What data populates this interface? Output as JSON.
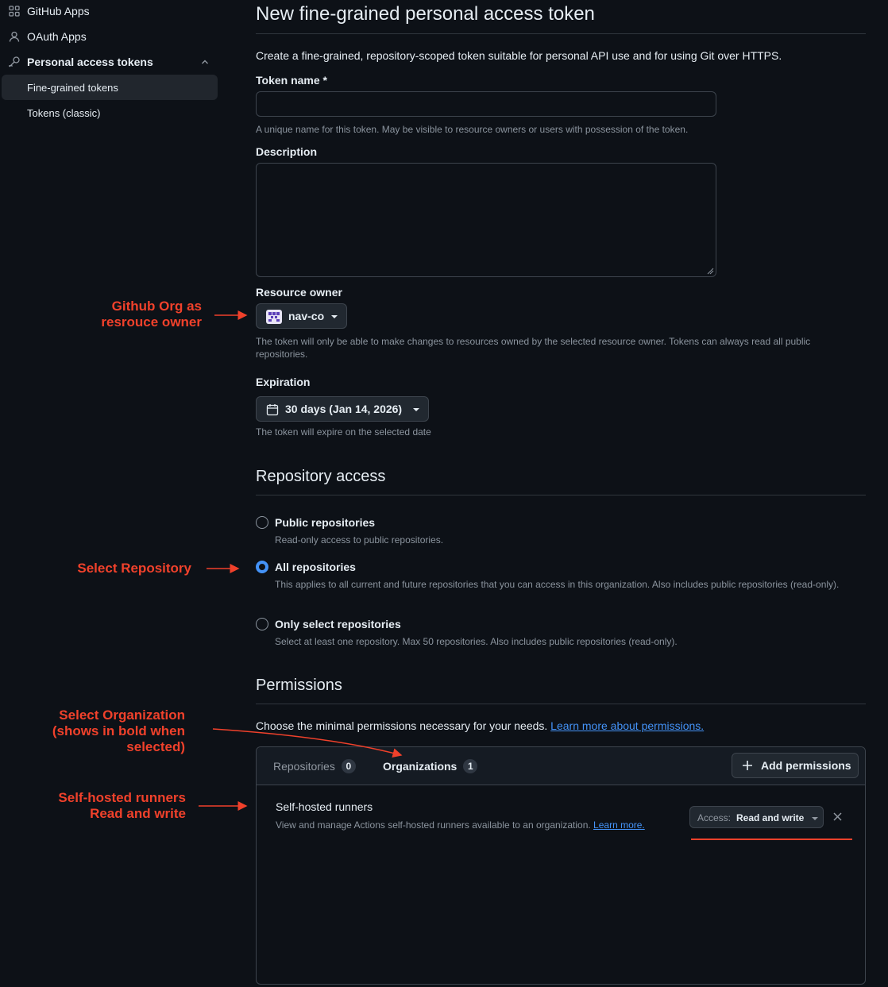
{
  "sidebar": {
    "items": [
      {
        "label": "GitHub Apps",
        "icon": "apps-icon"
      },
      {
        "label": "OAuth Apps",
        "icon": "person-icon"
      },
      {
        "label": "Personal access tokens",
        "icon": "key-icon"
      },
      {
        "label": "Fine-grained tokens"
      },
      {
        "label": "Tokens (classic)"
      }
    ]
  },
  "page": {
    "title": "New fine-grained personal access token",
    "intro": "Create a fine-grained, repository-scoped token suitable for personal API use and for using Git over HTTPS."
  },
  "form": {
    "token_name_label": "Token name *",
    "token_name_value": "",
    "token_name_note": "A unique name for this token. May be visible to resource owners or users with possession of the token.",
    "description_label": "Description",
    "description_value": "",
    "resource_owner_label": "Resource owner",
    "resource_owner_value": "nav-co",
    "resource_owner_note": "The token will only be able to make changes to resources owned by the selected resource owner. Tokens can always read all public repositories.",
    "expiration_label": "Expiration",
    "expiration_value": "30 days (Jan 14, 2026)",
    "expiration_note": "The token will expire on the selected date"
  },
  "repo_access": {
    "heading": "Repository access",
    "options": [
      {
        "title": "Public repositories",
        "desc": "Read-only access to public repositories.",
        "checked": false
      },
      {
        "title": "All repositories",
        "desc": "This applies to all current and future repositories that you can access in this organization. Also includes public repositories (read-only).",
        "checked": true
      },
      {
        "title": "Only select repositories",
        "desc": "Select at least one repository. Max 50 repositories. Also includes public repositories (read-only).",
        "checked": false
      }
    ]
  },
  "permissions": {
    "heading": "Permissions",
    "intro": "Choose the minimal permissions necessary for your needs.",
    "intro_link": "Learn more about permissions.",
    "tabs": [
      {
        "label": "Repositories",
        "count": "0",
        "selected": false
      },
      {
        "label": "Organizations",
        "count": "1",
        "selected": true
      }
    ],
    "add_button": "Add permissions",
    "items": [
      {
        "title": "Self-hosted runners",
        "desc": "View and manage Actions self-hosted runners available to an organization.",
        "link": "Learn more.",
        "access_prefix": "Access:",
        "access_value": "Read and write"
      }
    ]
  },
  "annotations": {
    "org_owner": "Github Org as\nresrouce owner",
    "select_repo": "Select Repository",
    "select_org": "Select Organization\n(shows in bold when\nselected)",
    "runners": "Self-hosted runners\nRead and write"
  },
  "colors": {
    "background": "#0d1117",
    "accent": "#4493f8",
    "annotation": "#f0412b",
    "border": "#3d444d"
  }
}
